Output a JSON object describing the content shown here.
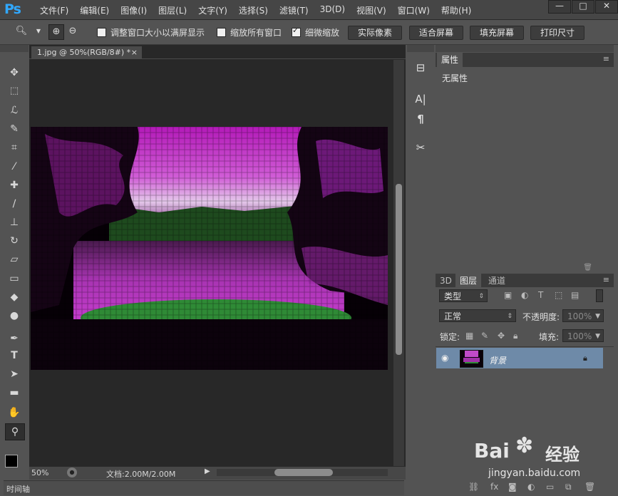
{
  "app": {
    "logo": "Ps"
  },
  "menu": [
    "文件(F)",
    "编辑(E)",
    "图像(I)",
    "图层(L)",
    "文字(Y)",
    "选择(S)",
    "滤镜(T)",
    "3D(D)",
    "视图(V)",
    "窗口(W)",
    "帮助(H)"
  ],
  "window_controls": {
    "minimize": "—",
    "maximize": "□",
    "close": "✕"
  },
  "options": {
    "resize_windows": {
      "label": "调整窗口大小以满屏显示",
      "checked": false
    },
    "zoom_all": {
      "label": "缩放所有窗口",
      "checked": false
    },
    "scrubby_zoom": {
      "label": "细微缩放",
      "checked": true
    },
    "btn_actual": "实际像素",
    "btn_fit": "适合屏幕",
    "btn_fill": "填充屏幕",
    "btn_print": "打印尺寸"
  },
  "document": {
    "tab_title": "1.jpg @ 50%(RGB/8#) *",
    "tab_close": "×",
    "zoom": "50%",
    "doc_size": "文档:2.00M/2.00M"
  },
  "timeline": {
    "label": "时间轴"
  },
  "properties": {
    "tab": "属性",
    "content": "无属性"
  },
  "layers_panel": {
    "tabs": [
      "3D",
      "图层",
      "通道"
    ],
    "filter": "类型",
    "blend_mode": "正常",
    "opacity_label": "不透明度:",
    "opacity_value": "100%",
    "lock_label": "锁定:",
    "fill_label": "填充:",
    "fill_value": "100%",
    "layer_name": "背景"
  },
  "watermark": {
    "brand": "Bai",
    "brand_cn": "经验",
    "url": "jingyan.baidu.com"
  },
  "colors": {
    "accent": "#31a8ff",
    "selected_layer": "#6e8aa8",
    "canvas_bg": "#282828",
    "panel_bg": "#535353",
    "menu_bg": "#464646"
  }
}
